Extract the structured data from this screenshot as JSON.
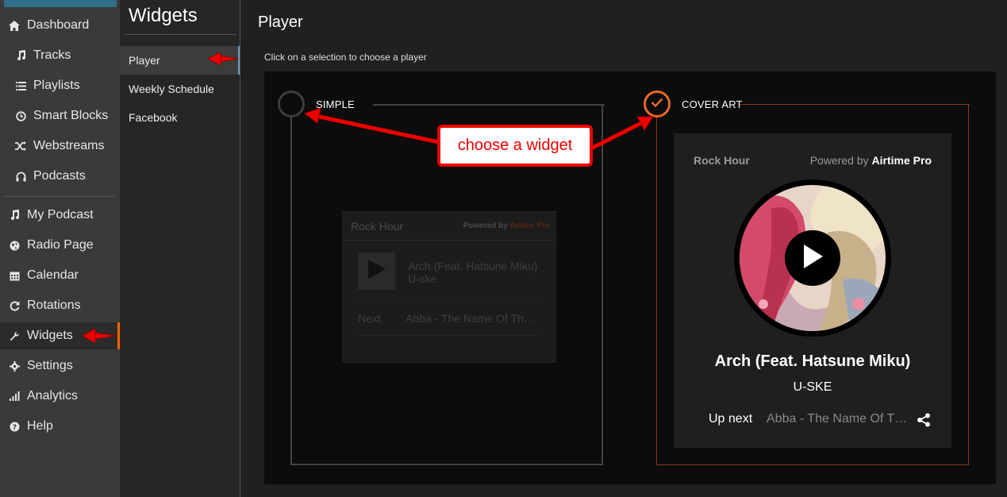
{
  "nav": {
    "items": [
      {
        "label": "Dashboard",
        "icon": "home-icon"
      },
      {
        "label": "Tracks",
        "icon": "music-note-icon"
      },
      {
        "label": "Playlists",
        "icon": "list-icon"
      },
      {
        "label": "Smart Blocks",
        "icon": "clock-icon"
      },
      {
        "label": "Webstreams",
        "icon": "shuffle-icon"
      },
      {
        "label": "Podcasts",
        "icon": "headphones-icon"
      },
      {
        "label": "My Podcast",
        "icon": "music-note-icon"
      },
      {
        "label": "Radio Page",
        "icon": "globe-icon"
      },
      {
        "label": "Calendar",
        "icon": "calendar-icon"
      },
      {
        "label": "Rotations",
        "icon": "refresh-icon"
      },
      {
        "label": "Widgets",
        "icon": "wrench-icon"
      },
      {
        "label": "Settings",
        "icon": "gear-icon"
      },
      {
        "label": "Analytics",
        "icon": "bar-chart-icon"
      },
      {
        "label": "Help",
        "icon": "help-icon"
      }
    ],
    "active": "Widgets"
  },
  "subnav": {
    "title": "Widgets",
    "items": [
      "Player",
      "Weekly Schedule",
      "Facebook"
    ],
    "active": "Player"
  },
  "main": {
    "title": "Player",
    "instruction": "Click on a selection to choose a player"
  },
  "options": {
    "simple": {
      "label": "SIMPLE",
      "station": "Rock Hour",
      "powered_prefix": "Powered by",
      "powered_brand": "Airtime Pro",
      "track_title": "Arch (Feat. Hatsune Miku)",
      "track_artist": "U-ske",
      "next_label": "Next",
      "next_value": "Abba - The Name Of The Game"
    },
    "cover_art": {
      "label": "COVER ART",
      "selected": true,
      "station": "Rock Hour",
      "powered_prefix": "Powered by",
      "powered_brand": "Airtime Pro",
      "track_title": "Arch (Feat. Hatsune Miku)",
      "track_artist": "U-SKE",
      "next_label": "Up next",
      "next_value": "Abba - The Name Of The Game"
    }
  },
  "annotation": {
    "callout": "choose a widget"
  },
  "colors": {
    "accent": "#ff6600",
    "annotation_red": "#ee0000",
    "selected_ring": "#e8682c"
  }
}
